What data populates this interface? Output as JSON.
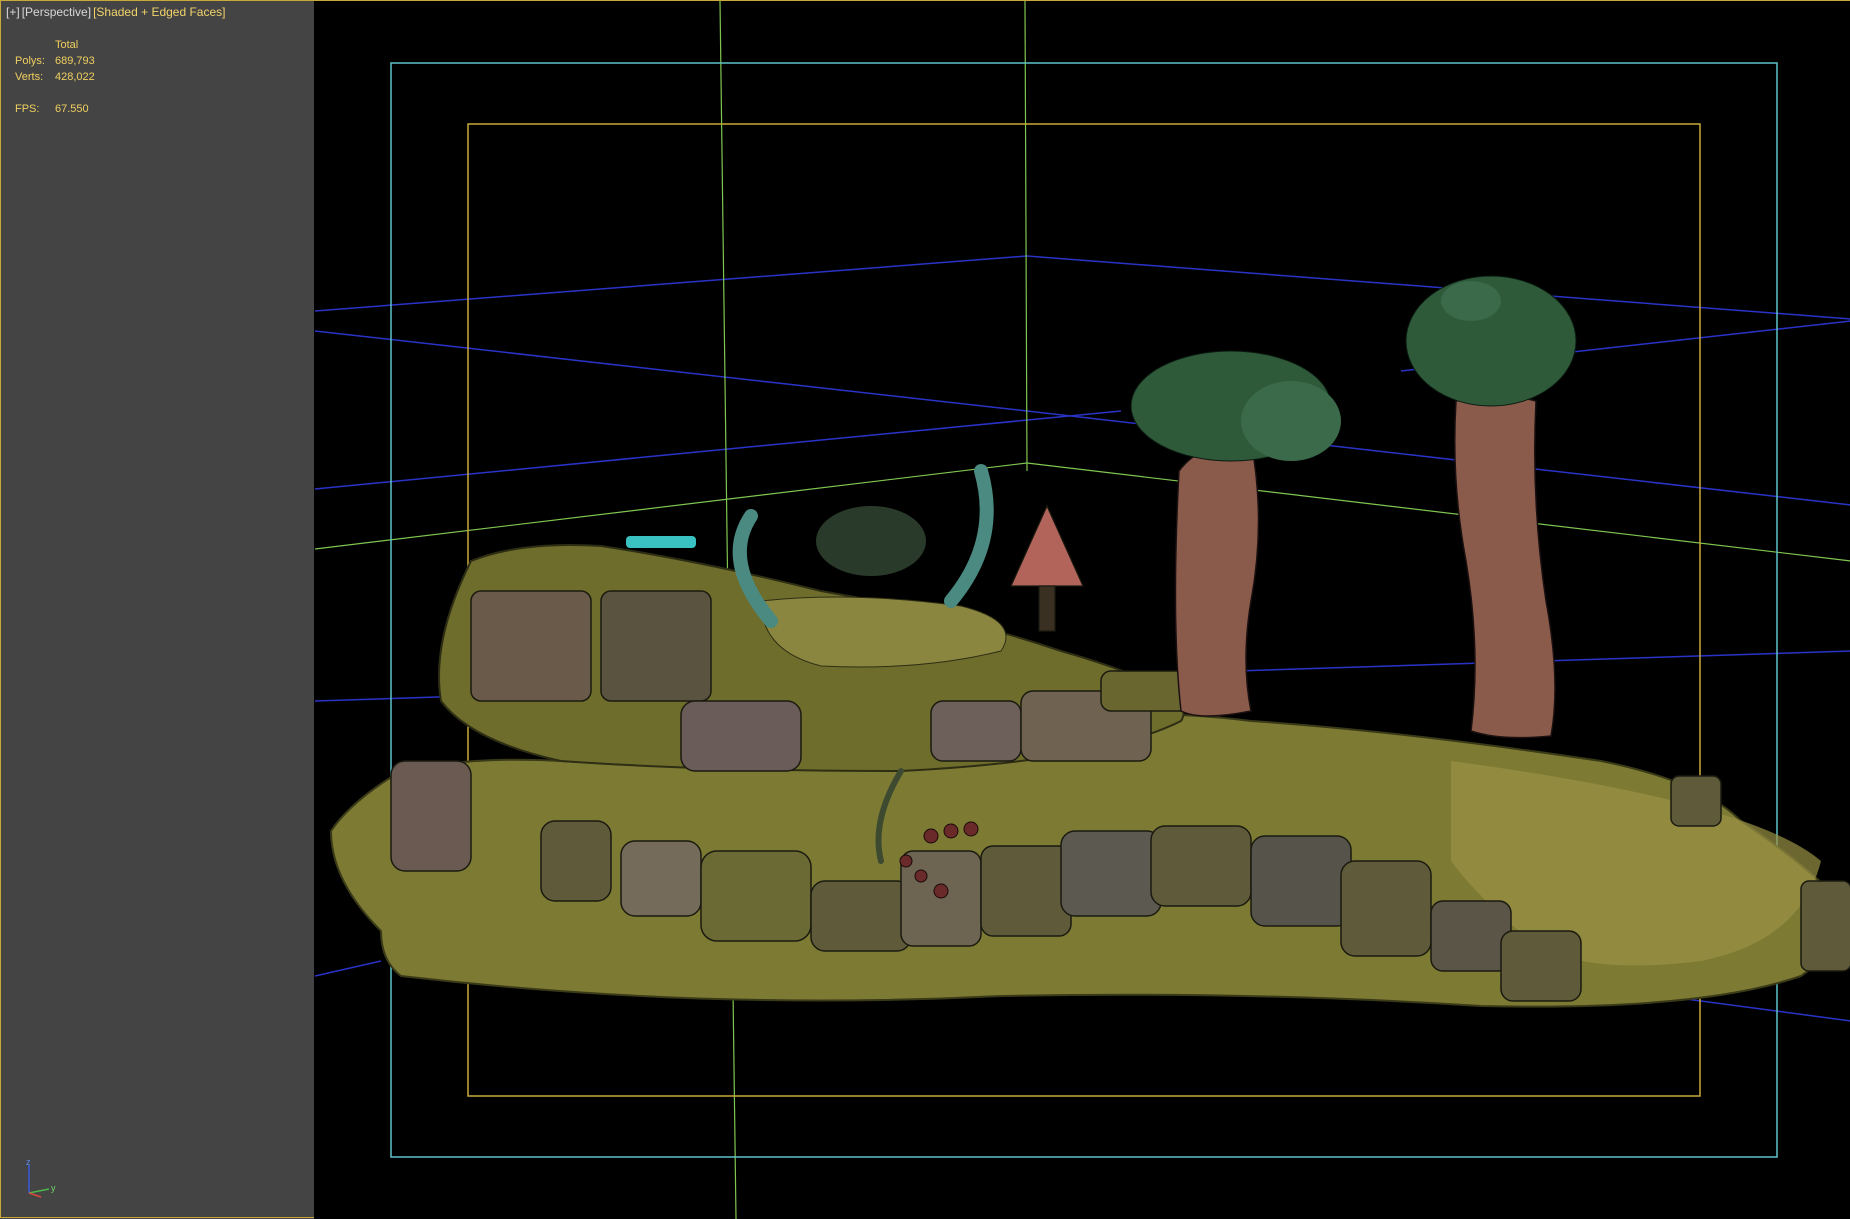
{
  "viewport_label": {
    "plus": "[+]",
    "view": "[Perspective]",
    "shading": "[Shaded + Edged Faces]"
  },
  "stats": {
    "header": "Total",
    "polys_label": "Polys:",
    "polys_value": "689,793",
    "verts_label": "Verts:",
    "verts_value": "428,022",
    "fps_label": "FPS:",
    "fps_value": "67.550"
  },
  "axis": {
    "z": "z",
    "y": "y"
  },
  "colors": {
    "viewport_bg": "#444444",
    "render_bg": "#000000",
    "safe_frame_outer": "#5fc3c9",
    "safe_frame_inner": "#c9a93a",
    "grid_blue": "#2a33c8",
    "axis_green": "#7fc650",
    "ground": "#8a8a3a",
    "trunk": "#8a5a4a",
    "foliage": "#2f5a3a"
  }
}
